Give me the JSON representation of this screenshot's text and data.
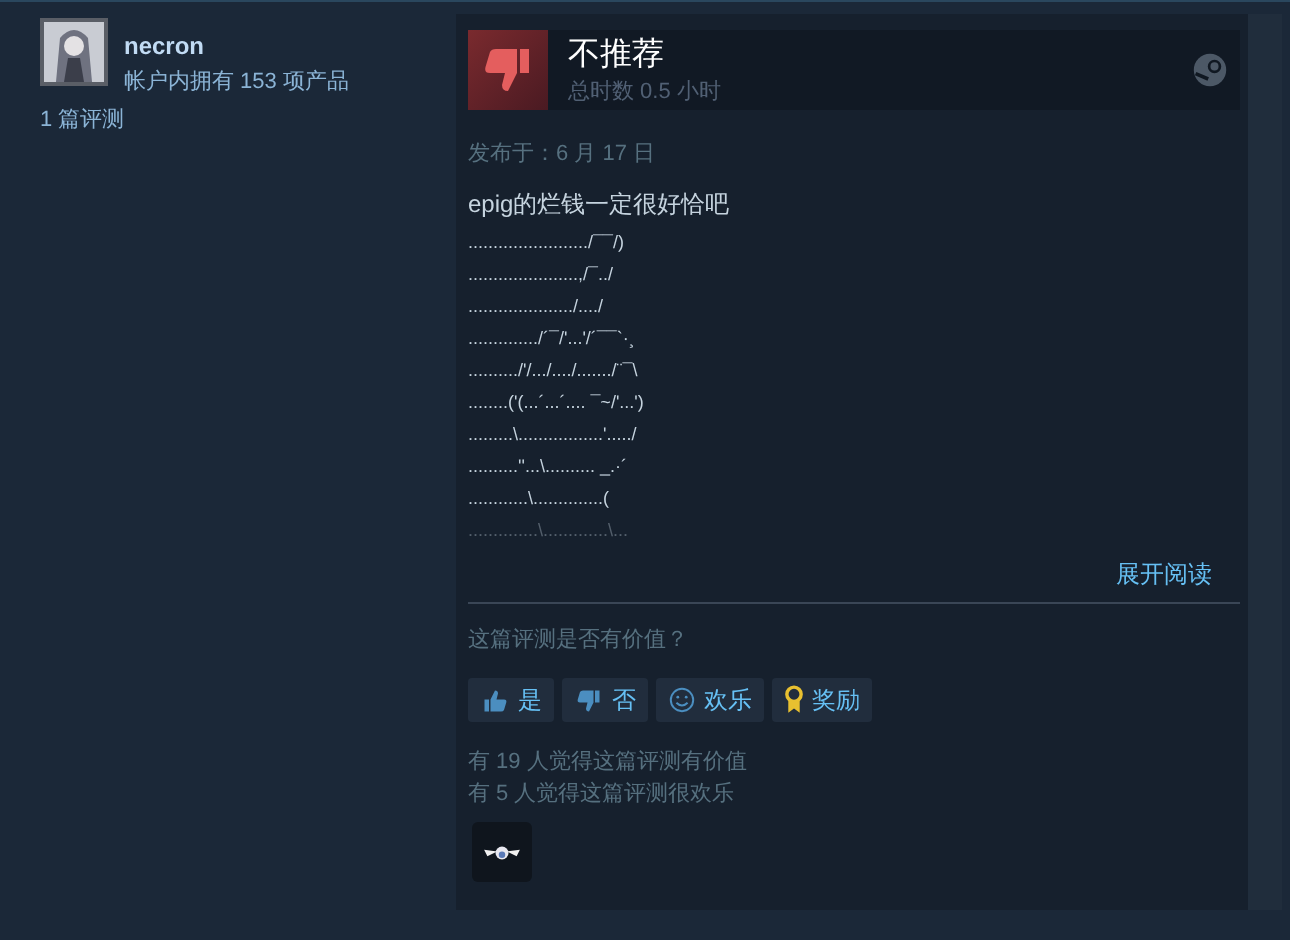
{
  "reviewer": {
    "name": "necron",
    "products": "帐户内拥有 153 项产品",
    "reviews": "1 篇评测"
  },
  "review": {
    "verdict": "不推荐",
    "recommended": false,
    "playtime": "总时数 0.5 小时",
    "posted": "发布于：6 月 17 日",
    "title_line": "epig的烂钱一定很好恰吧",
    "art_lines": [
      "......................../¯¯/)",
      "......................,/¯../",
      "...................../..../",
      "............../´¯/'...'/´¯¯`·¸",
      "........../'/.../..../......./¨¯\\",
      "........('(...´...´.... ¯~/'...')",
      ".........\\.................'...../",
      "..........''...\\.......... _.·´",
      "............\\..............(",
      "..............\\.............\\..."
    ],
    "expand": "展开阅读"
  },
  "feedback": {
    "question": "这篇评测是否有价值？",
    "buttons": [
      {
        "kind": "yes",
        "label": "是"
      },
      {
        "kind": "no",
        "label": "否"
      },
      {
        "kind": "funny",
        "label": "欢乐"
      },
      {
        "kind": "award",
        "label": "奖励"
      }
    ],
    "stats": [
      "有 19 人觉得这篇评测有价值",
      "有 5 人觉得这篇评测很欢乐"
    ]
  }
}
